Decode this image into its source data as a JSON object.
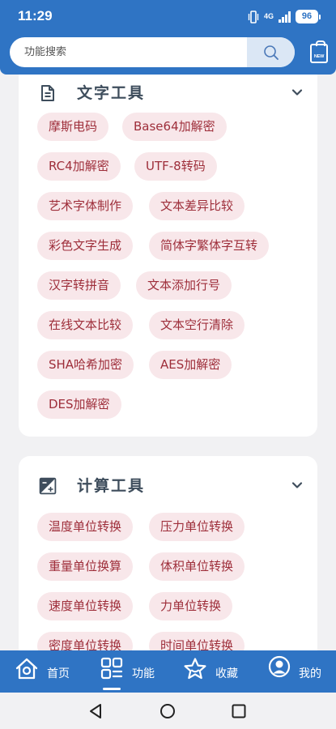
{
  "status_bar": {
    "time": "11:29",
    "network": "4G",
    "battery": "96"
  },
  "search": {
    "placeholder": "功能搜索",
    "new_badge": "NEW"
  },
  "sections": [
    {
      "title": "文字工具",
      "icon": "document-icon",
      "tags": [
        "摩斯电码",
        "Base64加解密",
        "RC4加解密",
        "UTF-8转码",
        "艺术字体制作",
        "文本差异比较",
        "彩色文字生成",
        "简体字繁体字互转",
        "汉字转拼音",
        "文本添加行号",
        "在线文本比较",
        "文本空行清除",
        "SHA哈希加密",
        "AES加解密",
        "DES加解密"
      ]
    },
    {
      "title": "计算工具",
      "icon": "calculator-icon",
      "tags": [
        "温度单位转换",
        "压力单位转换",
        "重量单位换算",
        "体积单位转换",
        "速度单位转换",
        "力单位转换",
        "密度单位转换",
        "时间单位转换"
      ]
    }
  ],
  "bottom_nav": [
    {
      "label": "首页",
      "icon": "home-icon"
    },
    {
      "label": "功能",
      "icon": "grid-icon"
    },
    {
      "label": "收藏",
      "icon": "star-icon"
    },
    {
      "label": "我的",
      "icon": "user-icon"
    }
  ],
  "colors": {
    "primary": "#2f74c4",
    "tag_bg": "#f8e7ea",
    "tag_text": "#9e2e3a",
    "page_bg": "#f1f1f3"
  }
}
